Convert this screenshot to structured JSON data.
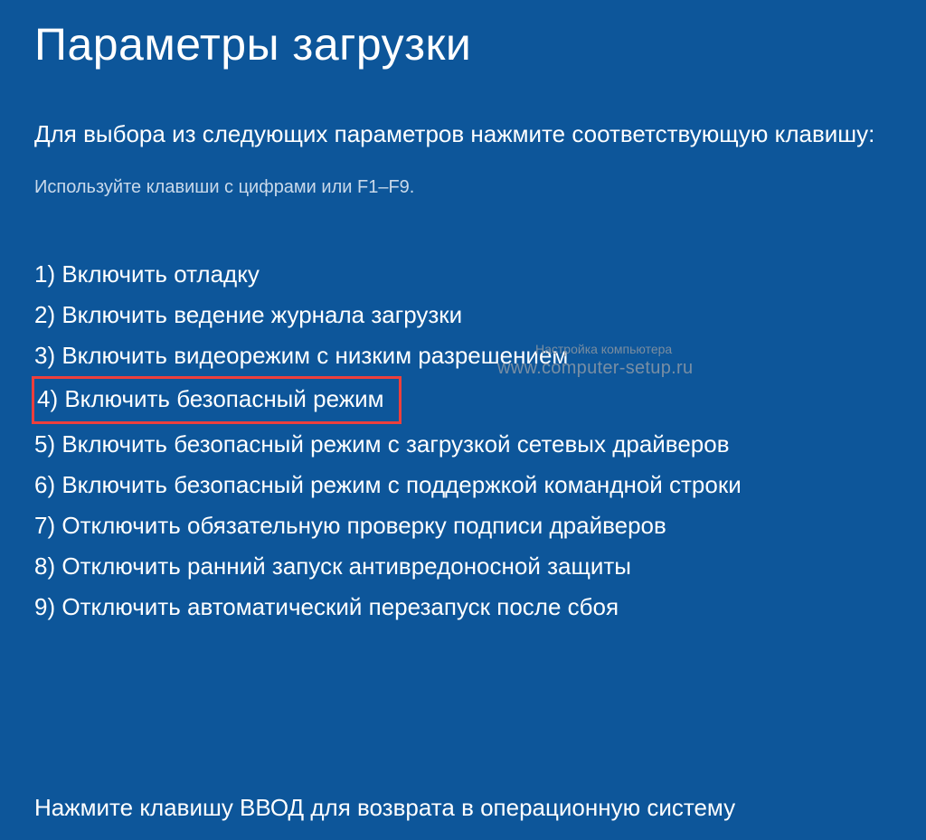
{
  "title": "Параметры загрузки",
  "instruction": "Для выбора из следующих параметров нажмите соответствующую клавишу:",
  "hint": "Используйте клавиши с цифрами или F1–F9.",
  "options": [
    "1) Включить отладку",
    "2) Включить ведение журнала загрузки",
    "3) Включить видеорежим с низким разрешением",
    "4) Включить безопасный режим",
    "5) Включить безопасный режим с загрузкой сетевых драйверов",
    "6) Включить безопасный режим с поддержкой командной строки",
    "7) Отключить обязательную проверку подписи драйверов",
    "8) Отключить ранний запуск антивредоносной защиты",
    "9) Отключить автоматический перезапуск после сбоя"
  ],
  "highlighted_index": 3,
  "footer": "Нажмите клавишу ВВОД для возврата в операционную систему",
  "watermark": {
    "line1": "Настройка компьютера",
    "line2": "www.computer-setup.ru"
  }
}
